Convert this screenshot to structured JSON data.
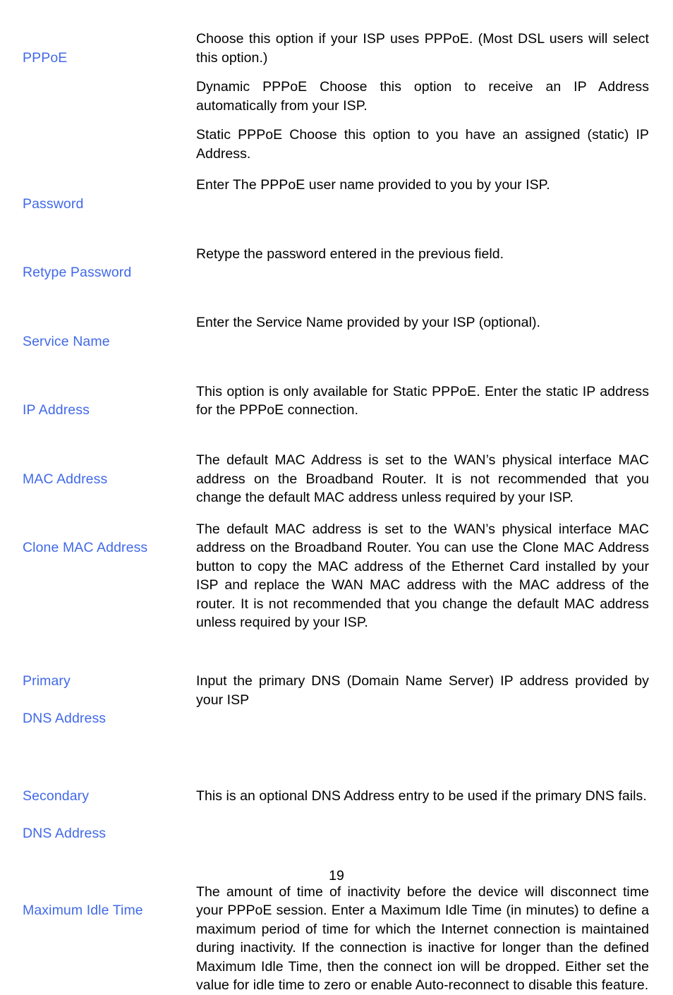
{
  "document": {
    "page_number": "19",
    "accent_color": "#4169e8",
    "text_color": "#000000",
    "background_color": "#ffffff"
  },
  "entries": [
    {
      "label": "PPPoE",
      "label_lines": [
        "PPPoE"
      ],
      "paragraphs": [
        "Choose this option if your ISP uses PPPoE. (Most DSL users will select this option.)",
        "Dynamic PPPoE Choose this option to receive an IP Address automatically from your ISP.",
        "Static PPPoE Choose this option to you have an assigned (static) IP Address."
      ]
    },
    {
      "label": "Password",
      "label_lines": [
        "Password"
      ],
      "paragraphs": [
        "Enter The PPPoE user name provided to you by your ISP."
      ]
    },
    {
      "label": "Retype Password",
      "label_lines": [
        "Retype Password"
      ],
      "paragraphs": [
        "Retype the password entered in the previous field."
      ]
    },
    {
      "label": "Service Name",
      "label_lines": [
        "Service Name"
      ],
      "paragraphs": [
        "Enter the Service Name provided by your ISP (optional)."
      ]
    },
    {
      "label": "IP Address",
      "label_lines": [
        "IP Address"
      ],
      "paragraphs": [
        "This option is only available for Static PPPoE. Enter the static IP address for the PPPoE connection."
      ]
    },
    {
      "label": "MAC Address",
      "label_lines": [
        "MAC Address"
      ],
      "paragraphs": [
        "The default MAC Address is set to the WAN’s physical interface MAC address on the Broadband Router. It is not recommended that you change the default MAC address unless required by your ISP."
      ]
    },
    {
      "label": "Clone MAC Address",
      "label_lines": [
        "Clone MAC Address"
      ],
      "paragraphs": [
        "The default MAC address is set to the WAN’s physical interface MAC address on the Broadband Router. You can use the Clone MAC Address button to copy the MAC address of the Ethernet Card installed by your ISP and replace the WAN MAC address with the MAC address of the router. It is not recommended that you change the default MAC address unless required by your ISP."
      ]
    },
    {
      "label": "Primary DNS Address",
      "label_lines": [
        "Primary",
        "DNS Address"
      ],
      "paragraphs": [
        "Input the primary DNS (Domain Name Server) IP address provided by your ISP"
      ]
    },
    {
      "label": "Secondary DNS Address",
      "label_lines": [
        "Secondary",
        "DNS Address"
      ],
      "paragraphs": [
        "This is an optional DNS Address entry to be used if the primary DNS fails."
      ]
    },
    {
      "label": "Maximum Idle Time",
      "label_lines": [
        "Maximum Idle Time"
      ],
      "paragraphs": [
        "The amount of time of inactivity before the device will disconnect time your PPPoE session. Enter a Maximum Idle Time (in minutes) to define a maximum period of time for which the Internet connection is maintained during inactivity. If the connection is inactive for longer than the defined Maximum Idle Time, then the connect ion will be dropped. Either set the value for idle time to zero or enable Auto-reconnect to disable this feature."
      ]
    }
  ]
}
